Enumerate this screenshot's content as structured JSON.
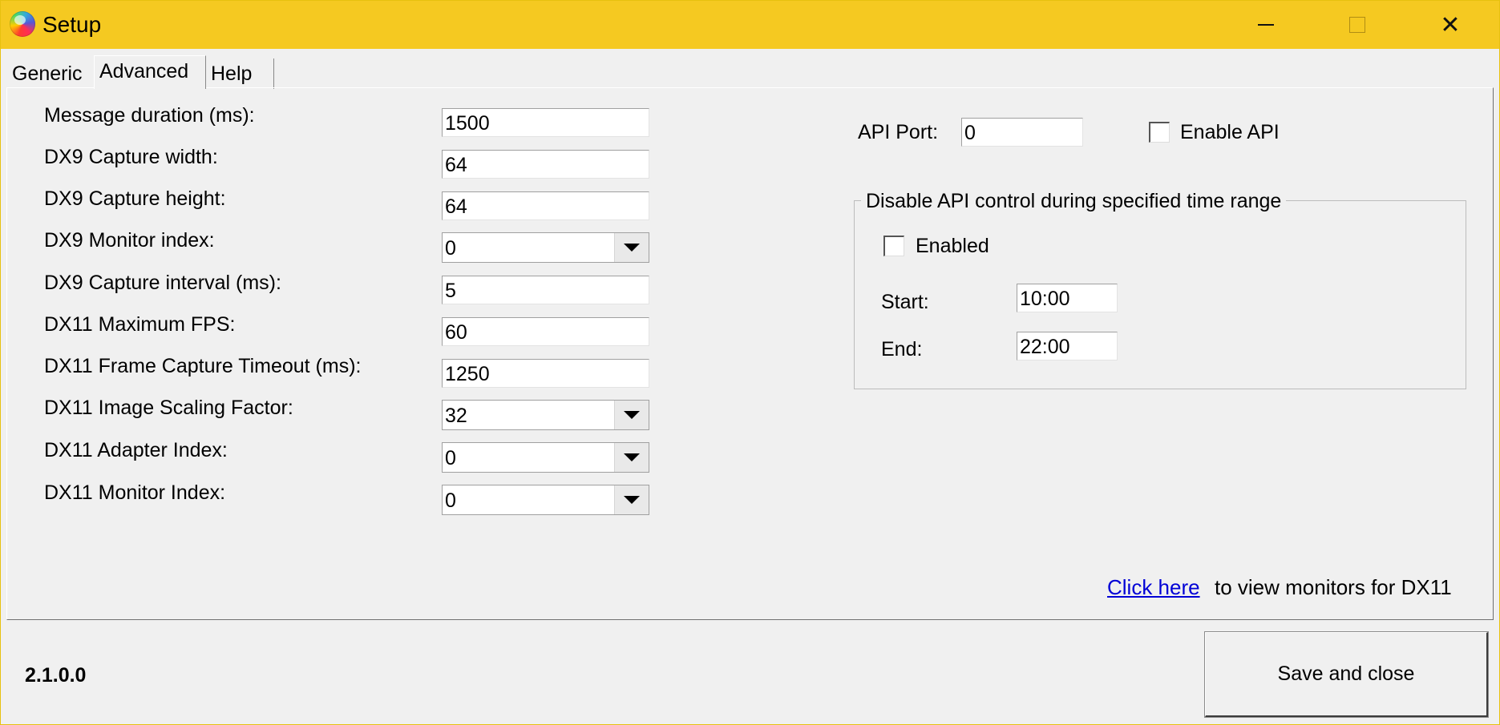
{
  "window": {
    "title": "Setup",
    "icon": "color-wheel-icon",
    "controls": {
      "minimize": "minimize-icon",
      "maximize": "maximize-icon",
      "close": "✕"
    },
    "titlebar_color": "#f5c921"
  },
  "tabs": [
    {
      "label": "Generic",
      "selected": false
    },
    {
      "label": "Advanced",
      "selected": true
    },
    {
      "label": "Help",
      "selected": false
    }
  ],
  "fields": [
    {
      "label": "Message duration (ms):",
      "value": "1500",
      "kind": "textbox"
    },
    {
      "label": "DX9 Capture width:",
      "value": "64",
      "kind": "textbox"
    },
    {
      "label": "DX9 Capture height:",
      "value": "64",
      "kind": "textbox"
    },
    {
      "label": "DX9 Monitor index:",
      "value": "0",
      "kind": "combo"
    },
    {
      "label": "DX9 Capture interval (ms):",
      "value": "5",
      "kind": "textbox"
    },
    {
      "label": "DX11 Maximum FPS:",
      "value": "60",
      "kind": "textbox"
    },
    {
      "label": "DX11 Frame Capture Timeout (ms):",
      "value": "1250",
      "kind": "textbox"
    },
    {
      "label": "DX11 Image Scaling Factor:",
      "value": "32",
      "kind": "combo"
    },
    {
      "label": "DX11 Adapter Index:",
      "value": "0",
      "kind": "combo"
    },
    {
      "label": "DX11 Monitor Index:",
      "value": "0",
      "kind": "combo"
    }
  ],
  "api": {
    "port_label": "API Port:",
    "port_value": "0",
    "enable_label": "Enable API",
    "enable_checked": false
  },
  "time_range": {
    "title": "Disable API control during specified time range",
    "enabled_label": "Enabled",
    "enabled_checked": false,
    "start_label": "Start:",
    "start_value": "10:00",
    "end_label": "End:",
    "end_value": "22:00"
  },
  "monitors_link": {
    "link_text": "Click here",
    "suffix": "to view monitors for DX11",
    "link_color": "#0000d6"
  },
  "footer": {
    "version": "2.1.0.0",
    "save_label": "Save and close"
  }
}
